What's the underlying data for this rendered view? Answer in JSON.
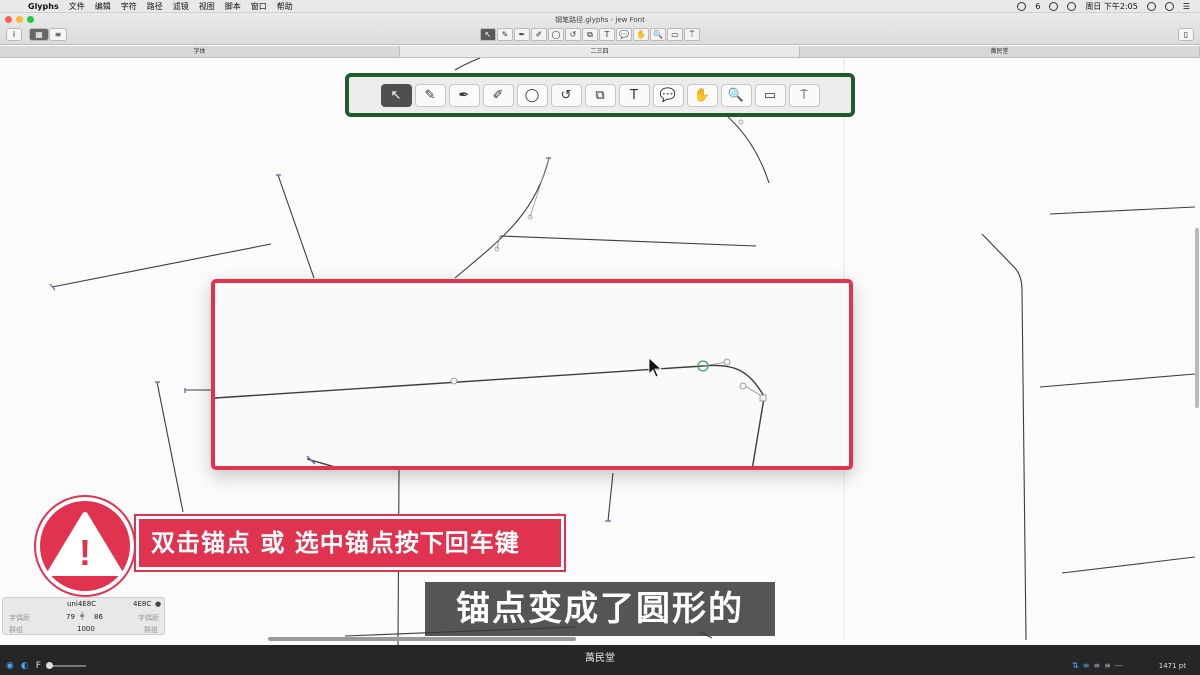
{
  "menubar": {
    "app_name": "Glyphs",
    "menus": [
      "文件",
      "编辑",
      "字符",
      "路径",
      "滤镜",
      "视图",
      "脚本",
      "窗口",
      "帮助"
    ],
    "battery": "6",
    "clock": "周日 下午2:05"
  },
  "window": {
    "title": "钢笔路径.glyphs - jew Font",
    "info_button": "i"
  },
  "mini_tools": [
    "↖",
    "✎",
    "✒",
    "✐",
    "◯",
    "↺",
    "⧉",
    "T",
    "💬",
    "✋",
    "🔍",
    "▭",
    "⍑"
  ],
  "tabs": [
    {
      "label": "字体",
      "active": false
    },
    {
      "label": "二三四",
      "active": true
    },
    {
      "label": "萬民堂",
      "active": false
    }
  ],
  "toolbar": {
    "tools": [
      {
        "name": "select-tool",
        "glyph": "↖",
        "active": true
      },
      {
        "name": "edit-tool",
        "glyph": "✎",
        "active": false
      },
      {
        "name": "pen-tool",
        "glyph": "✒",
        "active": false
      },
      {
        "name": "pencil-tool",
        "glyph": "✐",
        "active": false
      },
      {
        "name": "shape-tool",
        "glyph": "◯",
        "active": false
      },
      {
        "name": "rotate-tool",
        "glyph": "↺",
        "active": false
      },
      {
        "name": "scale-tool",
        "glyph": "⧉",
        "active": false
      },
      {
        "name": "text-tool",
        "glyph": "T",
        "active": false
      },
      {
        "name": "annotation-tool",
        "glyph": "💬",
        "active": false
      },
      {
        "name": "hand-tool",
        "glyph": "✋",
        "active": false
      },
      {
        "name": "zoom-tool",
        "glyph": "🔍",
        "active": false
      },
      {
        "name": "measure-tool",
        "glyph": "▭",
        "active": false
      },
      {
        "name": "type-tool",
        "glyph": "⍑",
        "active": false
      }
    ]
  },
  "warning": {
    "icon_mark": "!",
    "text": "双击锚点 或 选中锚点按下回车键"
  },
  "subtitle": "锚点变成了圆形的",
  "info_panel": {
    "glyph_name": "uni4E8C",
    "unicode": "4E8C",
    "lsb": "79",
    "rsb": "86",
    "width": "1000",
    "left_label": "字偶距",
    "right_label": "字偶距",
    "group_label": "群组",
    "group_label_right": "群组"
  },
  "bottombar": {
    "preview_text": "萬民堂",
    "zoom": "1471 pt"
  },
  "colors": {
    "accent_red": "#e0334f",
    "toolbar_border": "#1f5a2a",
    "node_green": "#3aa86b"
  }
}
